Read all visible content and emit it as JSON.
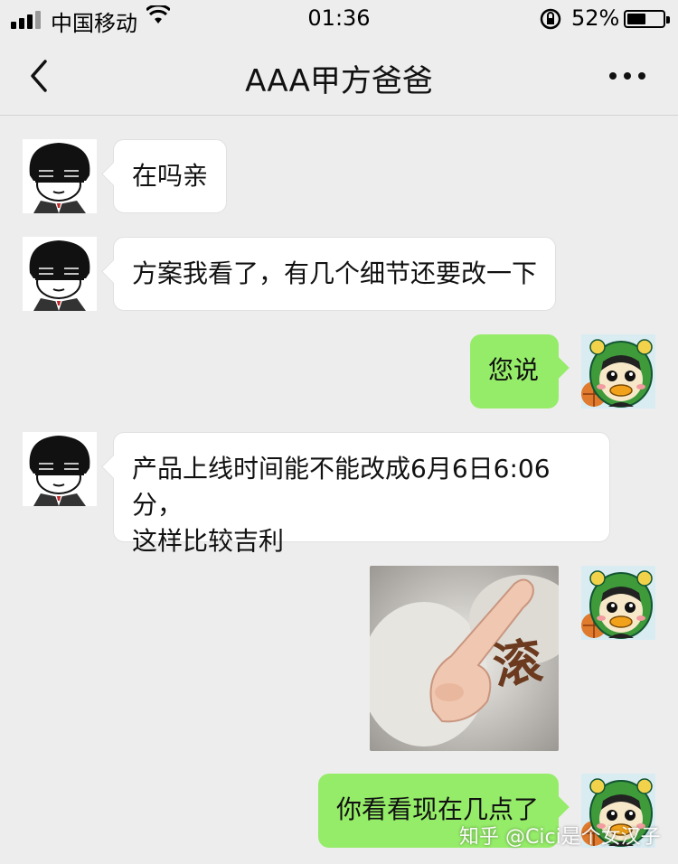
{
  "status_bar": {
    "carrier": "中国移动",
    "time": "01:36",
    "battery_percent": "52%",
    "battery_level": 0.52
  },
  "nav": {
    "title": "AAA甲方爸爸",
    "back_icon": "chevron-left-icon",
    "more_icon": "more-dots-icon"
  },
  "messages": [
    {
      "side": "left",
      "sender": "client",
      "text": "在吗亲"
    },
    {
      "side": "left",
      "sender": "client",
      "text": "方案我看了，有几个细节还要改一下"
    },
    {
      "side": "right",
      "sender": "me",
      "text": "您说"
    },
    {
      "side": "left",
      "sender": "client",
      "text_line1": "产品上线时间能不能改成6月6日6:06分，",
      "text_line2": "这样比较吉利"
    },
    {
      "side": "right",
      "sender": "me",
      "type": "sticker",
      "sticker_text": "滚"
    },
    {
      "side": "right",
      "sender": "me",
      "text": "你看看现在几点了"
    }
  ],
  "watermark": "知乎 @Cici是个女汉子",
  "colors": {
    "background": "#ededed",
    "bubble_self": "#95ec69",
    "bubble_other": "#ffffff"
  }
}
